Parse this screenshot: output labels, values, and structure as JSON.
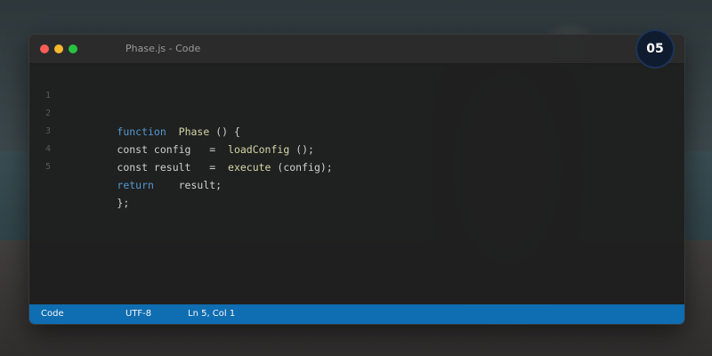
{
  "window": {
    "title": "Phase.js - Code"
  },
  "badge": {
    "number": "05"
  },
  "editor": {
    "lines": [
      {
        "num": "1",
        "parts": [
          {
            "t": "function",
            "c": "kw"
          },
          {
            "t": "  "
          },
          {
            "t": "Phase",
            "c": "fn"
          },
          {
            "t": " () {"
          }
        ]
      },
      {
        "num": "2",
        "parts": [
          {
            "t": "const config   =  "
          },
          {
            "t": "loadConfig",
            "c": "fn"
          },
          {
            "t": " ();"
          }
        ]
      },
      {
        "num": "3",
        "parts": [
          {
            "t": "const result   =  "
          },
          {
            "t": "execute",
            "c": "fn"
          },
          {
            "t": " (config);"
          }
        ]
      },
      {
        "num": "4",
        "parts": [
          {
            "t": "return",
            "c": "kw"
          },
          {
            "t": "    result;"
          }
        ]
      },
      {
        "num": "5",
        "parts": [
          {
            "t": "};"
          }
        ]
      }
    ]
  },
  "statusbar": {
    "language": "Code",
    "encoding": "UTF-8",
    "position": "Ln 5, Col 1"
  },
  "colors": {
    "keyword": "#569cd6",
    "function": "#dcdcaa",
    "statusbar": "#0e6fb6"
  }
}
